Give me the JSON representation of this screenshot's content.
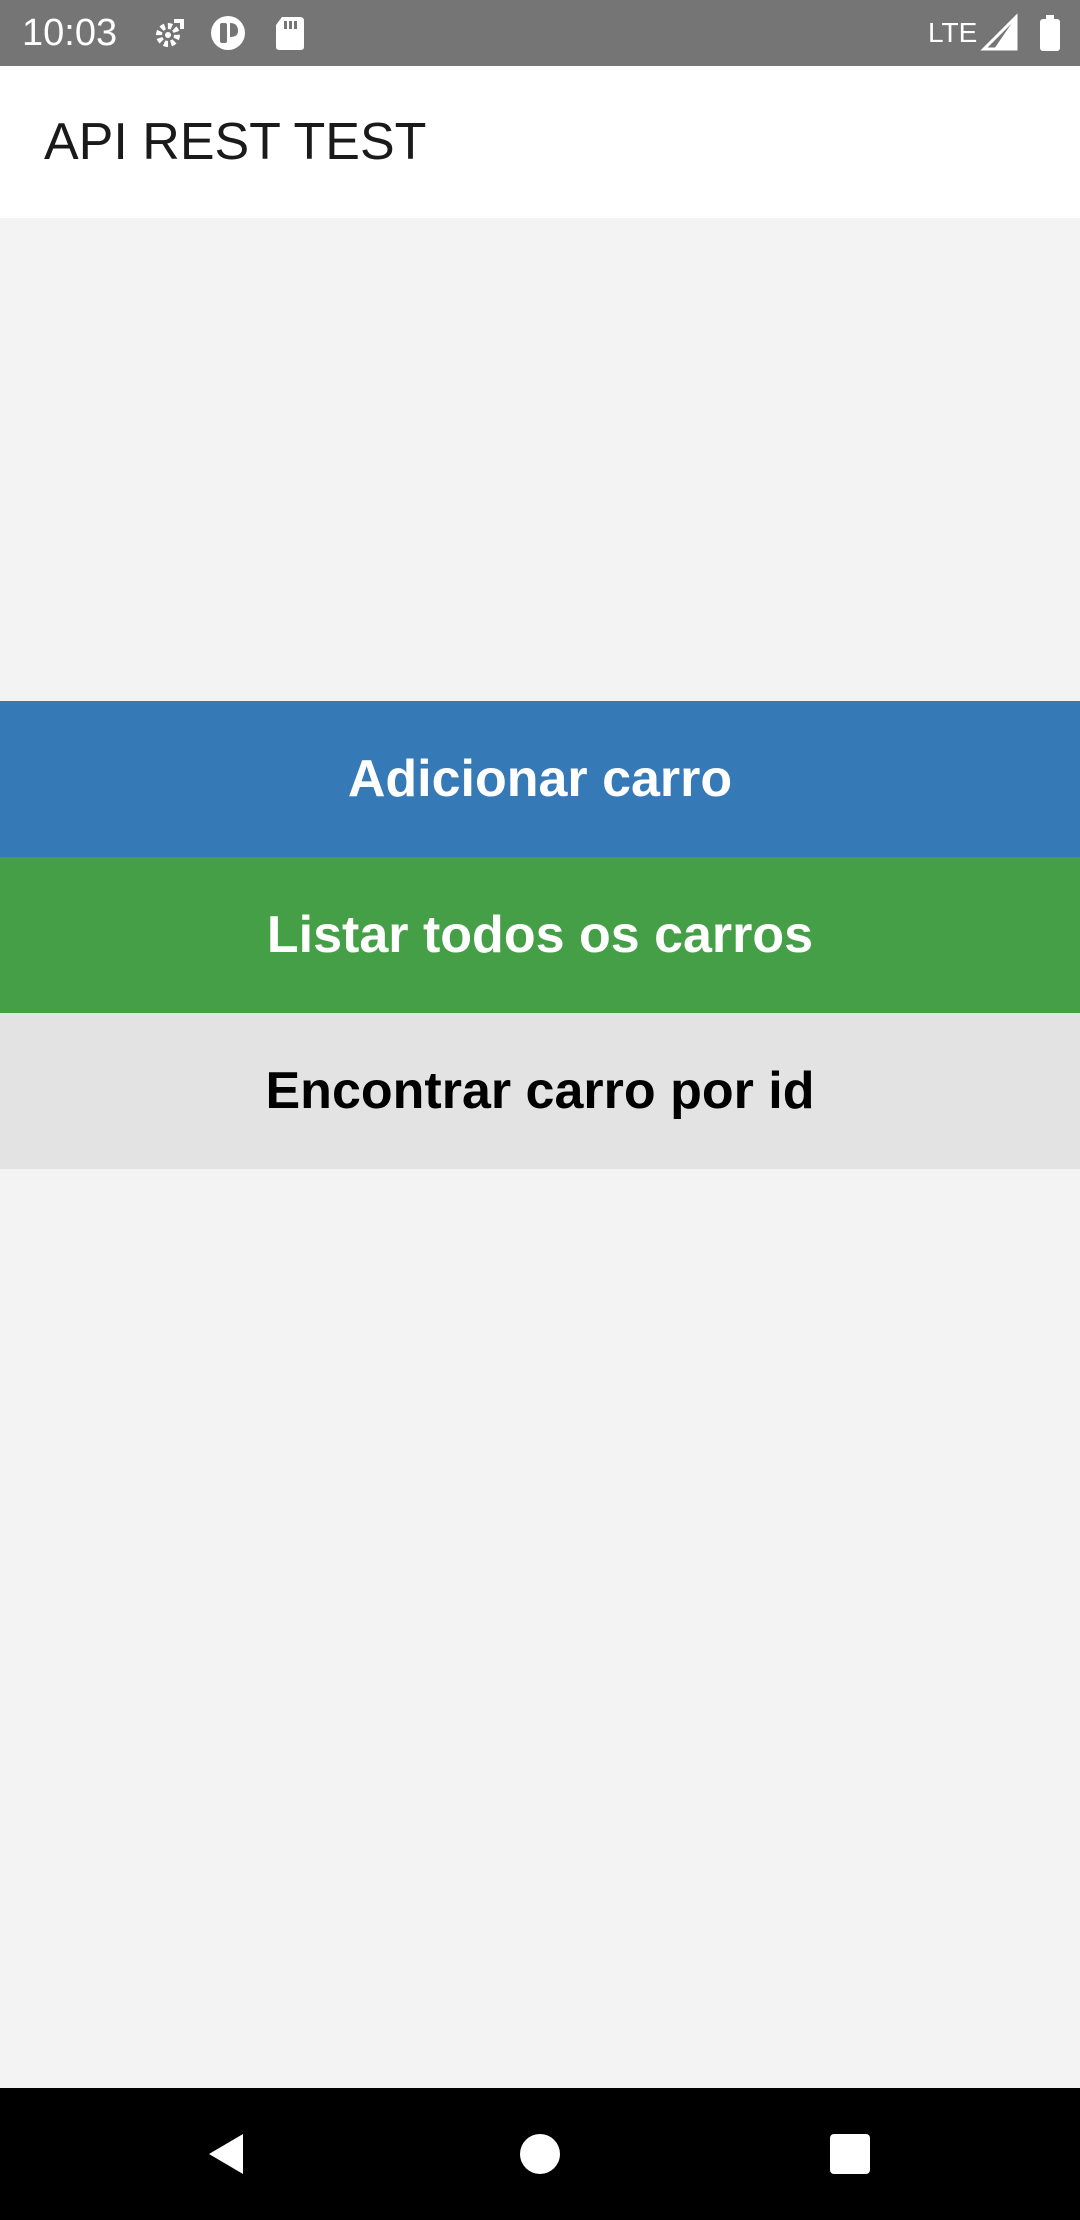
{
  "status_bar": {
    "time": "10:03",
    "network": "LTE",
    "icons": [
      "settings-icon",
      "data-saver-icon",
      "sd-card-icon",
      "signal-icon",
      "battery-icon"
    ]
  },
  "app_bar": {
    "title": "API REST TEST"
  },
  "buttons": {
    "add_car": "Adicionar carro",
    "list_cars": "Listar todos os carros",
    "find_car": "Encontrar carro por id"
  },
  "colors": {
    "add_button": "#3579b6",
    "list_button": "#459f46",
    "find_button": "#e3e3e3",
    "background": "#f3f3f3",
    "status_bar": "#757575"
  },
  "nav_bar": {
    "icons": [
      "back-icon",
      "home-icon",
      "recents-icon"
    ]
  }
}
